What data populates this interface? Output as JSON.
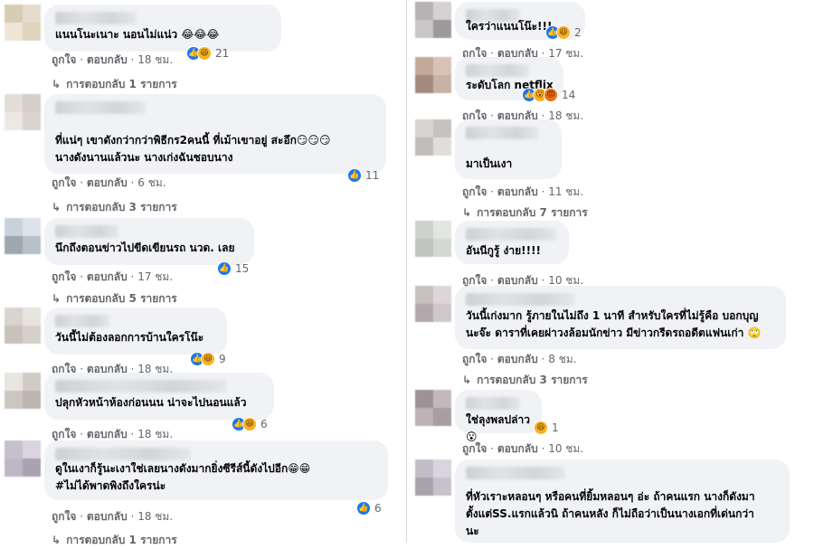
{
  "left_column": [
    {
      "text": "แนนโนะเนาะ นอนไม่แน่ว 😂😂😂",
      "reaction_count": "21",
      "reactions": [
        "like",
        "haha"
      ],
      "time": "18 ชม.",
      "replies": "การตอบกลับ 1 รายการ"
    },
    {
      "text": "ที่แน่ๆ เขาดังกว่ากว่าพิธีกร2คนนี้ ที่เม้าเขาอยู่ สะอึก😏😏😏\nนางดังนานแล้วนะ นางเก่งฉันชอบนาง",
      "reaction_count": "11",
      "reactions": [
        "like"
      ],
      "time": "6 ชม.",
      "replies": "การตอบกลับ 3 รายการ"
    },
    {
      "text": "นึกถึงตอนข่าวไปขีดเขียนรถ นวด. เลย",
      "reaction_count": "15",
      "reactions": [
        "like"
      ],
      "time": "17 ชม.",
      "replies": "การตอบกลับ 5 รายการ"
    },
    {
      "text": "วันนี้ไม่ต้องลอกการบ้านใครโน๊ะ",
      "reaction_count": "9",
      "reactions": [
        "like",
        "haha"
      ],
      "time": "18 ชม.",
      "replies": ""
    },
    {
      "text": "ปลุกหัวหน้าห้องก่อนนน น่าจะไปนอนแล้ว",
      "reaction_count": "6",
      "reactions": [
        "like",
        "haha"
      ],
      "time": "18 ชม.",
      "replies": ""
    },
    {
      "text": "ดูในเงาก็รู้นะเงาใช่เลยนางดังมากยิ่งซีรีส์นี้ดังไปอีก😁😁\n#ไม่ได้พาดพิงถึงใครน่ะ",
      "reaction_count": "6",
      "reactions": [
        "like"
      ],
      "time": "18 ชม.",
      "replies": "การตอบกลับ 1 รายการ"
    }
  ],
  "right_column": [
    {
      "text": "ใครว่าแนนโน๊ะ!!!",
      "reaction_count": "2",
      "reactions": [
        "like",
        "haha"
      ],
      "time": "17 ชม.",
      "replies": ""
    },
    {
      "text": "ระดับโลก netflix",
      "reaction_count": "14",
      "reactions": [
        "like",
        "wow",
        "angry"
      ],
      "time": "18 ชม.",
      "replies": ""
    },
    {
      "text": "มาเป็นเงา",
      "reaction_count": "",
      "reactions": [],
      "time": "11 ชม.",
      "replies": "การตอบกลับ 7 รายการ"
    },
    {
      "text": "อันนีกูรู้ ง่าย!!!!",
      "reaction_count": "",
      "reactions": [],
      "time": "10 ชม.",
      "replies": ""
    },
    {
      "text": "วันนี้เก่งมาก รู้ภายในไม่ถึง 1 นาที สำหรับใครที่ไม่รู้คือ บอกบุญ\nนะจ๊ะ ดาราที่เคยผ่าวงล้อมนักข่าว มีข่าวกรีดรถอดีตแฟนเก่า 🙄",
      "reaction_count": "",
      "reactions": [],
      "time": "8 ชม.",
      "replies": "การตอบกลับ 3 รายการ"
    },
    {
      "text": "ใช่ลุงพลปล่าว 😮",
      "reaction_count": "1",
      "reactions": [
        "haha"
      ],
      "time": "10 ชม.",
      "replies": ""
    },
    {
      "text": "ที่หัวเราะหลอนๆ หรือคนที่ยิ้มหลอนๆ อ่ะ ถ้าคนแรก นางก็ดังมา\nตั้งแต่SS.แรกแล้วนิ ถ้าคนหลัง ก็ไม่ถือว่าเป็นนางเอกที่เด่นกว่า\nนะ",
      "reaction_count": "",
      "reactions": [],
      "time": "",
      "replies": ""
    }
  ],
  "labels": {
    "like": "ถูกใจ",
    "reply": "ตอบกลับ",
    "sep": " · "
  },
  "colors": {
    "bubble": "#f0f2f5",
    "meta": "#65676b",
    "like": "#1877f2",
    "haha": "#f7b125"
  }
}
